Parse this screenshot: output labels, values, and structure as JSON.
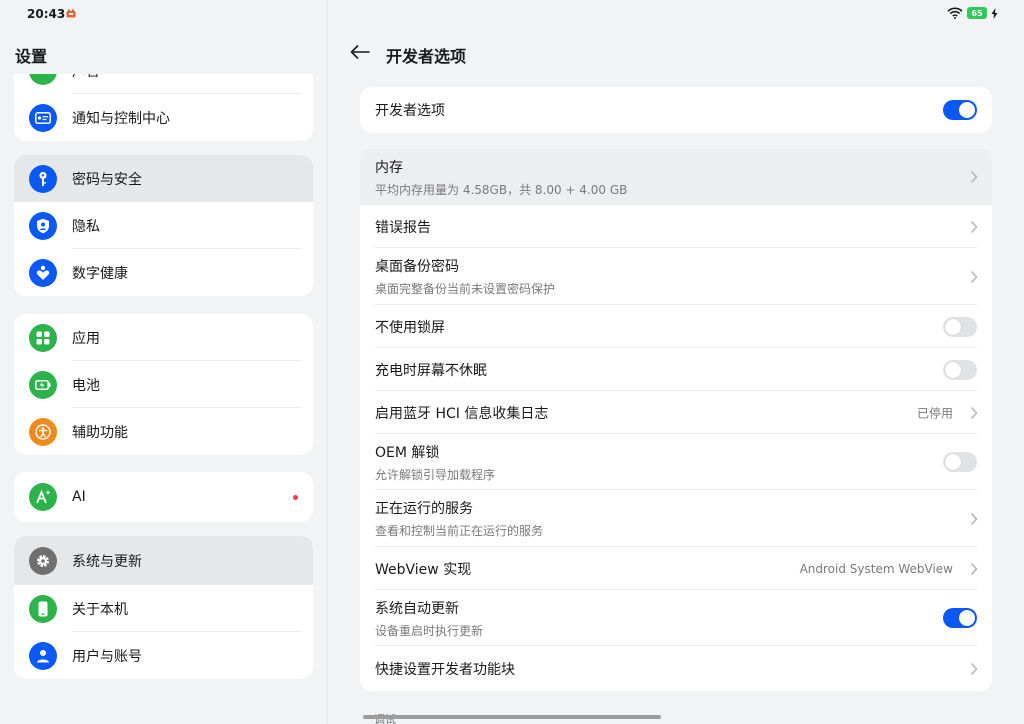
{
  "status_bar": {
    "time": "20:43",
    "battery": "65"
  },
  "left": {
    "title": "设置",
    "groups": [
      {
        "items": [
          {
            "label": "声音",
            "icon": "sound-icon",
            "color": "#2cb34a"
          },
          {
            "label": "通知与控制中心",
            "icon": "notification-icon",
            "color": "#0a59f7"
          }
        ]
      },
      {
        "items": [
          {
            "label": "密码与安全",
            "icon": "key-icon",
            "color": "#0a59f7"
          },
          {
            "label": "隐私",
            "icon": "privacy-icon",
            "color": "#0a59f7"
          },
          {
            "label": "数字健康",
            "icon": "digital-health-icon",
            "color": "#0a59f7"
          }
        ]
      },
      {
        "items": [
          {
            "label": "应用",
            "icon": "apps-icon",
            "color": "#2cb34a"
          },
          {
            "label": "电池",
            "icon": "battery-icon",
            "color": "#2cb34a"
          },
          {
            "label": "辅助功能",
            "icon": "accessibility-icon",
            "color": "#f08a1c"
          }
        ]
      },
      {
        "items": [
          {
            "label": "AI",
            "icon": "ai-icon",
            "color": "#2cb34a"
          }
        ]
      },
      {
        "items": [
          {
            "label": "系统与更新",
            "icon": "gear-icon",
            "color": "#6f6f6f"
          },
          {
            "label": "关于本机",
            "icon": "phone-icon",
            "color": "#2cb34a"
          },
          {
            "label": "用户与账号",
            "icon": "user-icon",
            "color": "#0a59f7"
          }
        ]
      }
    ]
  },
  "right": {
    "title": "开发者选项",
    "dev_options": {
      "label": "开发者选项",
      "enabled": true
    },
    "items": [
      {
        "label": "内存",
        "sub": "平均内存用量为 4.58GB，共 8.00 + 4.00 GB"
      },
      {
        "label": "错误报告"
      },
      {
        "label": "桌面备份密码",
        "sub": "桌面完整备份当前未设置密码保护"
      },
      {
        "label": "不使用锁屏",
        "enabled": false
      },
      {
        "label": "充电时屏幕不休眠",
        "enabled": false
      },
      {
        "label": "启用蓝牙 HCI 信息收集日志",
        "value": "已停用"
      },
      {
        "label": "OEM 解锁",
        "sub": "允许解锁引导加载程序",
        "enabled": false
      },
      {
        "label": "正在运行的服务",
        "sub": "查看和控制当前正在运行的服务"
      },
      {
        "label": "WebView 实现",
        "value": "Android System WebView"
      },
      {
        "label": "系统自动更新",
        "sub": "设备重启时执行更新",
        "enabled": true
      },
      {
        "label": "快捷设置开发者功能块"
      }
    ],
    "footer": "调试"
  },
  "colors": {
    "accent": "#0a59f7",
    "toggle_off": "#e1e2e4",
    "badge": "#e84057"
  }
}
